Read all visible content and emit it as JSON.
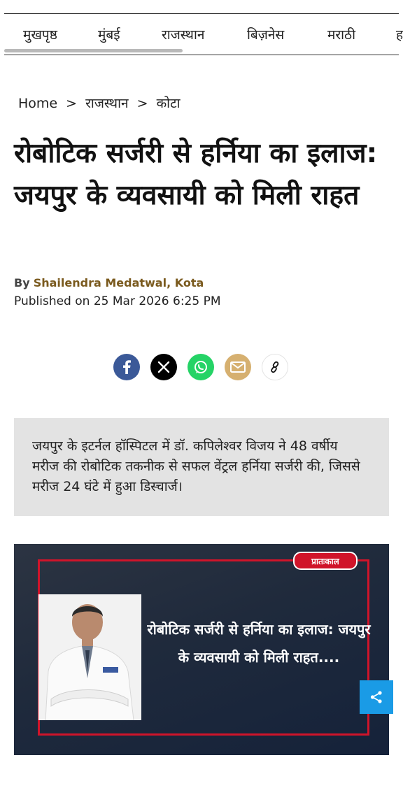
{
  "nav": {
    "items": [
      "मुखपृष्ठ",
      "मुंबई",
      "राजस्थान",
      "बिज़नेस",
      "मराठी",
      "ह"
    ]
  },
  "breadcrumb": {
    "home": "Home",
    "section": "राजस्थान",
    "city": "कोटा",
    "separator": ">"
  },
  "article": {
    "headline": "रोबोटिक सर्जरी से हर्निया का इलाज: जयपुर के व्यवसायी को मिली राहत",
    "by_label": "By",
    "author": "Shailendra Medatwal, Kota",
    "published": "Published on 25 Mar 2026 6:25 PM",
    "summary": "जयपुर के इटर्नल हॉस्पिटल में डॉ. कपिलेश्वर विजय ने 48 वर्षीय मरीज की रोबोटिक तकनीक से सफल वेंट्रल हर्निया सर्जरी की, जिससे मरीज 24 घंटे में हुआ डिस्चार्ज।"
  },
  "share": {
    "buttons": [
      {
        "icon": "facebook-icon",
        "color": "#3b5998"
      },
      {
        "icon": "x-icon",
        "color": "#000000"
      },
      {
        "icon": "whatsapp-icon",
        "color": "#25d366"
      },
      {
        "icon": "email-icon",
        "color": "#d6b070"
      },
      {
        "icon": "link-icon",
        "color": "#ffffff"
      }
    ]
  },
  "hero": {
    "logo": "प्रातःकाल",
    "caption": "रोबोटिक सर्जरी से हर्निया का इलाज: जयपुर के व्यवसायी को मिली राहत....",
    "accent_color": "#d0142a"
  },
  "floating": {
    "icon": "share-icon",
    "color": "#1a9be6"
  }
}
